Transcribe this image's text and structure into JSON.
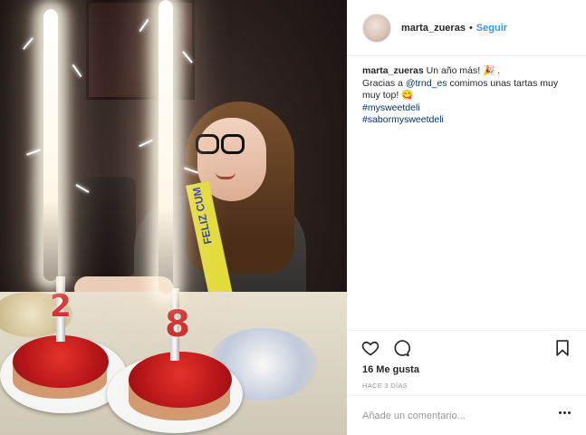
{
  "post": {
    "username": "marta_zueras",
    "follow_label": "Seguir",
    "separator": "•",
    "caption": {
      "username": "marta_zueras",
      "line1_text": " Un año más! 🎉 .",
      "line2_prefix": "Gracias a ",
      "mention": "@trnd_es",
      "line2_suffix": " comimos unas tartas muy muy top! 😋",
      "hashtags": [
        "#mysweetdeli",
        "#sabormysweetdeli"
      ]
    },
    "likes": "16 Me gusta",
    "timestamp": "HACE 3 DÍAS",
    "comment_placeholder": "Añade un comentario..."
  },
  "photo": {
    "candle_digits": [
      "2",
      "8"
    ],
    "sash_text": "FELIZ CUM"
  },
  "colors": {
    "link": "#3897f0",
    "hashtag": "#003569",
    "text": "#262626",
    "muted": "#999999",
    "divider": "#efefef"
  },
  "icons": {
    "like": "heart-icon",
    "comment": "comment-bubble-icon",
    "save": "bookmark-icon",
    "more": "more-options-icon"
  }
}
